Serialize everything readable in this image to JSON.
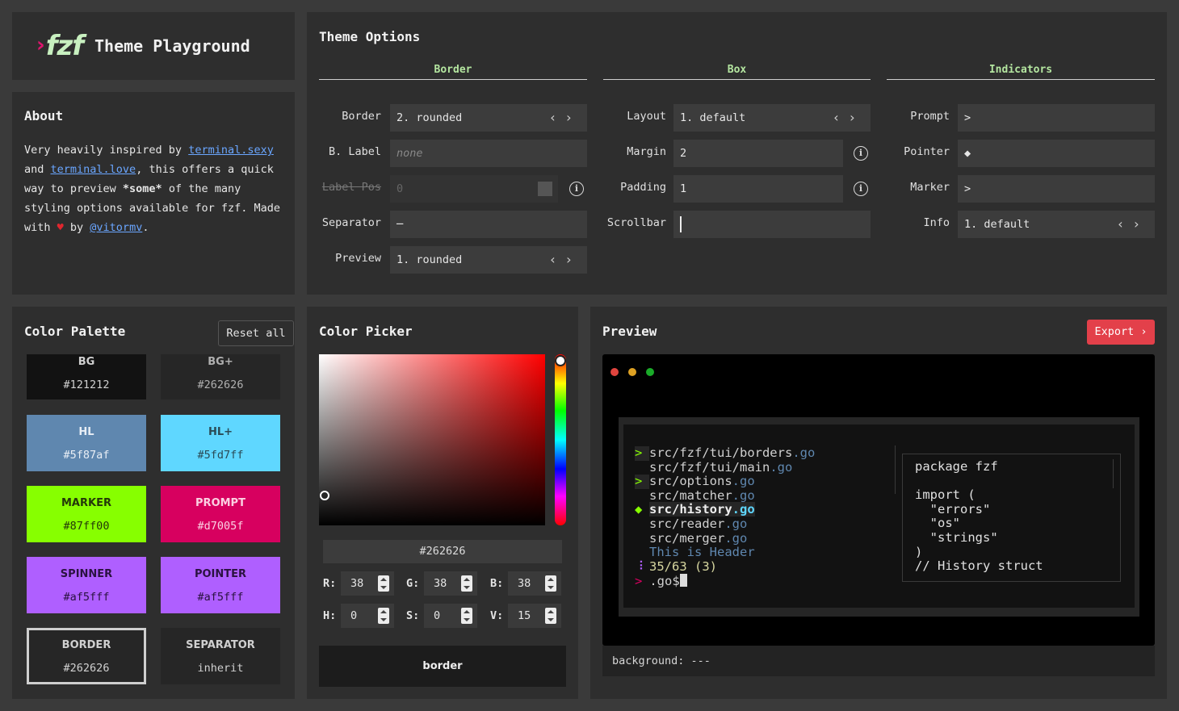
{
  "app": {
    "logo_text": "fzf",
    "logo_chevron": "›",
    "title": "Theme Playground"
  },
  "about": {
    "title": "About",
    "text_1": "Very heavily inspired by ",
    "link_1": "terminal.sexy",
    "text_2": " and ",
    "link_2": "terminal.love",
    "text_3": ", this offers a quick way to preview ",
    "text_4": "*some*",
    "text_5": " of the many styling options available for fzf. Made with ",
    "heart": "♥",
    "text_6": " by ",
    "link_3": "@vitormv",
    "text_7": "."
  },
  "theme_options": {
    "title": "Theme Options",
    "columns": {
      "border": "Border",
      "box": "Box",
      "indicators": "Indicators"
    },
    "border": {
      "border_label": "Border",
      "border_value": "2. rounded",
      "blabel_label": "B. Label",
      "blabel_placeholder": "none",
      "labelpos_label": "Label Pos",
      "labelpos_value": "0",
      "separator_label": "Separator",
      "separator_value": "─",
      "preview_label": "Preview",
      "preview_value": "1. rounded"
    },
    "box": {
      "layout_label": "Layout",
      "layout_value": "1. default",
      "margin_label": "Margin",
      "margin_value": "2",
      "padding_label": "Padding",
      "padding_value": "1",
      "scrollbar_label": "Scrollbar",
      "scrollbar_value": ""
    },
    "indicators": {
      "prompt_label": "Prompt",
      "prompt_value": ">",
      "pointer_label": "Pointer",
      "pointer_value": "◆",
      "marker_label": "Marker",
      "marker_value": ">",
      "info_label": "Info",
      "info_value": "1. default"
    },
    "arrow_left": "‹",
    "arrow_right": "›",
    "info_icon": "i"
  },
  "palette": {
    "title": "Color Palette",
    "reset_label": "Reset all",
    "swatches": [
      {
        "name": "BG",
        "value": "#121212",
        "bg": "#121212",
        "fg": "#d0d0d0"
      },
      {
        "name": "BG+",
        "value": "#262626",
        "bg": "#262626",
        "fg": "#b0b0b0"
      },
      {
        "name": "HL",
        "value": "#5f87af",
        "bg": "#5f87af",
        "fg": "#e8eef5"
      },
      {
        "name": "HL+",
        "value": "#5fd7ff",
        "bg": "#5fd7ff",
        "fg": "#2a4a55"
      },
      {
        "name": "MARKER",
        "value": "#87ff00",
        "bg": "#87ff00",
        "fg": "#24380a"
      },
      {
        "name": "PROMPT",
        "value": "#d7005f",
        "bg": "#d7005f",
        "fg": "#fbd0e2"
      },
      {
        "name": "SPINNER",
        "value": "#af5fff",
        "bg": "#af5fff",
        "fg": "#2a1240"
      },
      {
        "name": "POINTER",
        "value": "#af5fff",
        "bg": "#af5fff",
        "fg": "#2a1240"
      },
      {
        "name": "BORDER",
        "value": "#262626",
        "bg": "#262626",
        "fg": "#d0d0d0"
      },
      {
        "name": "SEPARATOR",
        "value": "inherit",
        "bg": "#262626",
        "fg": "#d0d0d0"
      }
    ]
  },
  "picker": {
    "title": "Color Picker",
    "hex": "#262626",
    "r_label": "R:",
    "r": "38",
    "g_label": "G:",
    "g": "38",
    "b_label": "B:",
    "b": "38",
    "h_label": "H:",
    "h": "0",
    "s_label": "S:",
    "s": "0",
    "v_label": "V:",
    "v": "15",
    "target": "border"
  },
  "preview": {
    "title": "Preview",
    "export_label": "Export ›",
    "traffic_lights": [
      "#e0443e",
      "#dea123",
      "#1aab29"
    ],
    "list": [
      {
        "gutter": ">",
        "path": "src/fzf/tui/borders",
        "ext": ".go"
      },
      {
        "gutter": "",
        "path": "src/fzf/tui/main",
        "ext": ".go"
      },
      {
        "gutter": ">",
        "path": "src/options",
        "ext": ".go"
      },
      {
        "gutter": "",
        "path": "src/matcher",
        "ext": ".go"
      },
      {
        "gutter": "◆",
        "path": "src/history",
        "ext": ".go"
      },
      {
        "gutter": "",
        "path": "src/reader",
        "ext": ".go"
      },
      {
        "gutter": "",
        "path": "src/merger",
        "ext": ".go"
      }
    ],
    "header": "This is Header",
    "info_spinner": "⠸",
    "info": "35/63 (3)",
    "prompt": ">",
    "query": " .go$",
    "preview_text": "package fzf\n\nimport (\n  \"errors\"\n  \"os\"\n  \"strings\"\n)\n// History struct",
    "status": "background: ---"
  }
}
